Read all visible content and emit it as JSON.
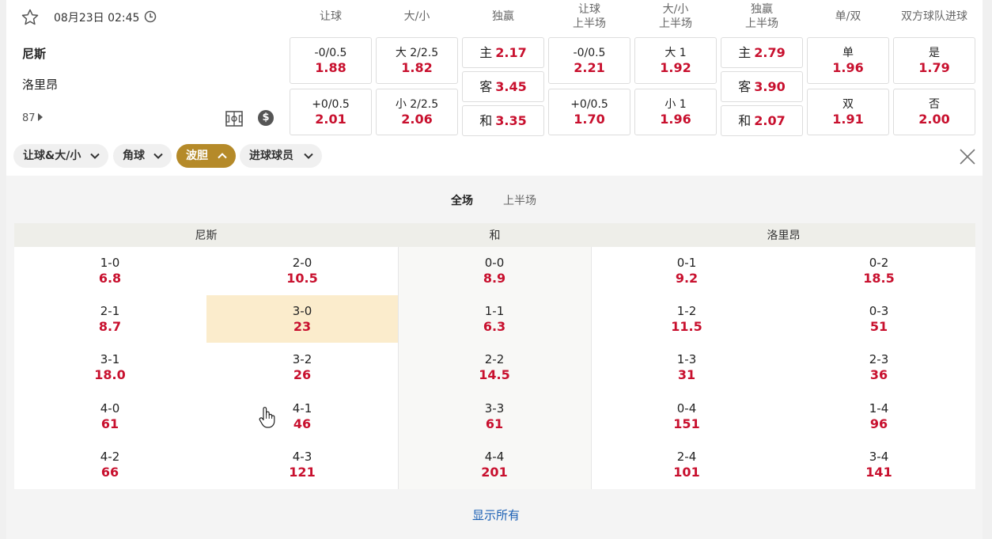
{
  "match": {
    "datetime": "08月23日 02:45",
    "home": "尼斯",
    "away": "洛里昂",
    "minute": "87"
  },
  "markets": [
    {
      "title": [
        "让球"
      ]
    },
    {
      "title": [
        "大/小"
      ]
    },
    {
      "title": [
        "独赢"
      ]
    },
    {
      "title": [
        "让球",
        "上半场"
      ]
    },
    {
      "title": [
        "大/小",
        "上半场"
      ]
    },
    {
      "title": [
        "独赢",
        "上半场"
      ]
    },
    {
      "title": [
        "单/双"
      ]
    },
    {
      "title": [
        "双方球队进球"
      ]
    }
  ],
  "odds": {
    "handicap": [
      {
        "label": "-0/0.5",
        "value": "1.88"
      },
      {
        "label": "+0/0.5",
        "value": "2.01"
      }
    ],
    "total": [
      {
        "label": "大 2/2.5",
        "value": "1.82"
      },
      {
        "label": "小 2/2.5",
        "value": "2.06"
      }
    ],
    "moneyline": [
      {
        "label": "主",
        "value": "2.17"
      },
      {
        "label": "客",
        "value": "3.45"
      },
      {
        "label": "和",
        "value": "3.35"
      }
    ],
    "handicap_1h": [
      {
        "label": "-0/0.5",
        "value": "2.21"
      },
      {
        "label": "+0/0.5",
        "value": "1.70"
      }
    ],
    "total_1h": [
      {
        "label": "大 1",
        "value": "1.92"
      },
      {
        "label": "小 1",
        "value": "1.96"
      }
    ],
    "moneyline_1h": [
      {
        "label": "主",
        "value": "2.79"
      },
      {
        "label": "客",
        "value": "3.90"
      },
      {
        "label": "和",
        "value": "2.07"
      }
    ],
    "odd_even": [
      {
        "label": "单",
        "value": "1.96"
      },
      {
        "label": "双",
        "value": "1.91"
      }
    ],
    "btts": [
      {
        "label": "是",
        "value": "1.79"
      },
      {
        "label": "否",
        "value": "2.00"
      }
    ]
  },
  "filters": [
    {
      "label": "让球&大/小",
      "active": false
    },
    {
      "label": "角球",
      "active": false
    },
    {
      "label": "波胆",
      "active": true
    },
    {
      "label": "进球球员",
      "active": false
    }
  ],
  "tabs": [
    {
      "label": "全场",
      "active": true
    },
    {
      "label": "上半场",
      "active": false
    }
  ],
  "correct_score": {
    "headers": {
      "home": "尼斯",
      "draw": "和",
      "away": "洛里昂"
    },
    "rows": [
      [
        {
          "s": "1-0",
          "o": "6.8"
        },
        {
          "s": "2-0",
          "o": "10.5"
        },
        {
          "s": "0-0",
          "o": "8.9"
        },
        {
          "s": "0-1",
          "o": "9.2"
        },
        {
          "s": "0-2",
          "o": "18.5"
        }
      ],
      [
        {
          "s": "2-1",
          "o": "8.7"
        },
        {
          "s": "3-0",
          "o": "23"
        },
        {
          "s": "1-1",
          "o": "6.3"
        },
        {
          "s": "1-2",
          "o": "11.5"
        },
        {
          "s": "0-3",
          "o": "51"
        }
      ],
      [
        {
          "s": "3-1",
          "o": "18.0"
        },
        {
          "s": "3-2",
          "o": "26"
        },
        {
          "s": "2-2",
          "o": "14.5"
        },
        {
          "s": "1-3",
          "o": "31"
        },
        {
          "s": "2-3",
          "o": "36"
        }
      ],
      [
        {
          "s": "4-0",
          "o": "61"
        },
        {
          "s": "4-1",
          "o": "46"
        },
        {
          "s": "3-3",
          "o": "61"
        },
        {
          "s": "0-4",
          "o": "151"
        },
        {
          "s": "1-4",
          "o": "96"
        }
      ],
      [
        {
          "s": "4-2",
          "o": "66"
        },
        {
          "s": "4-3",
          "o": "121"
        },
        {
          "s": "4-4",
          "o": "201"
        },
        {
          "s": "2-4",
          "o": "101"
        },
        {
          "s": "3-4",
          "o": "141"
        }
      ]
    ],
    "highlighted": "3-0"
  },
  "show_all": "显示所有",
  "colors": {
    "odds": "#c8102e",
    "active_chip": "#b58a29",
    "link": "#1a5fb4",
    "highlight": "#fbeccc"
  }
}
